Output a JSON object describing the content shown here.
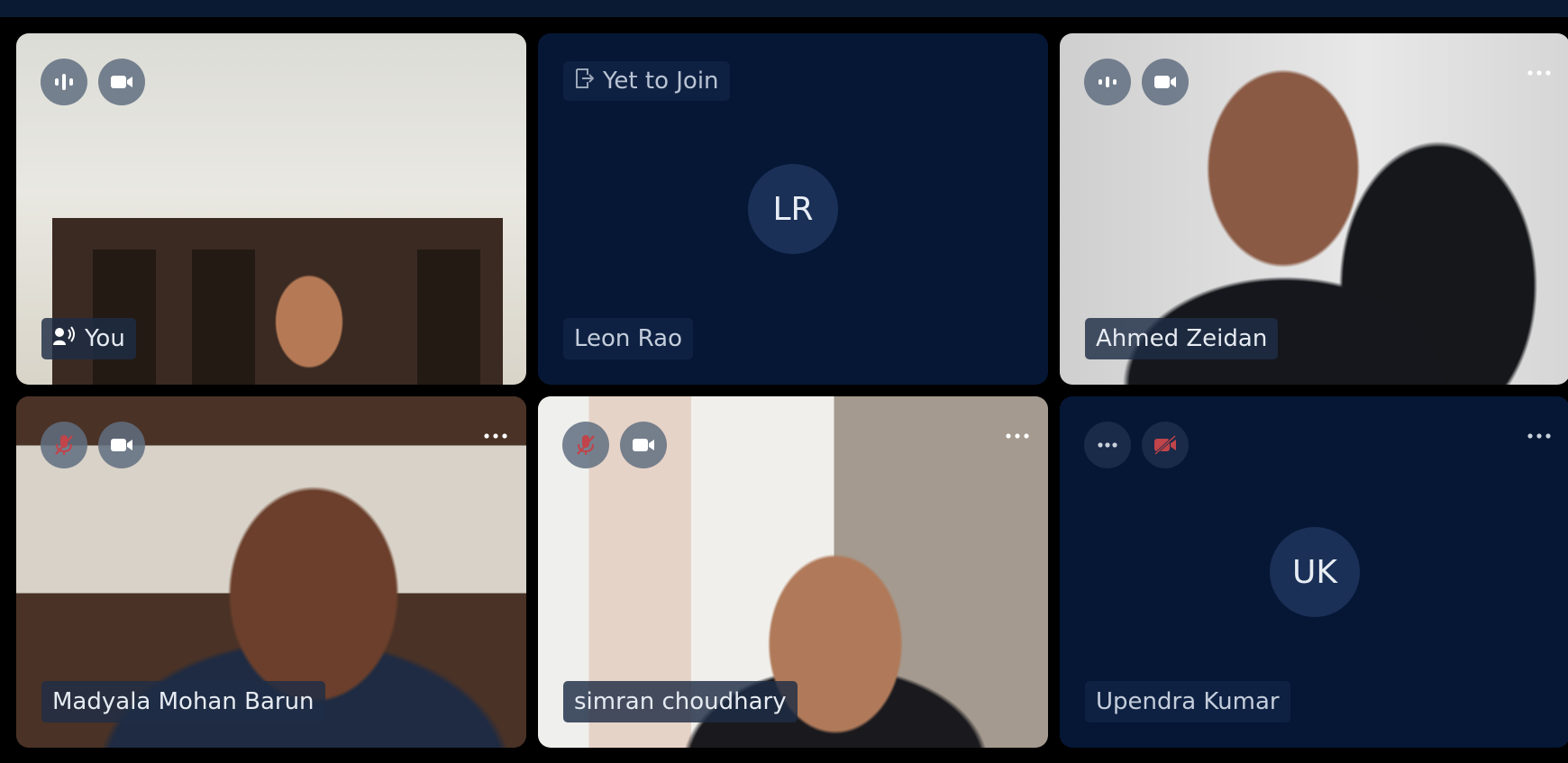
{
  "participants": [
    {
      "name": "You",
      "has_speaking_indicator": true,
      "mic_icon": "audio-level-icon",
      "camera_icon": "video-camera-icon",
      "view": "video"
    },
    {
      "status": "Yet to Join",
      "status_icon": "exit-door-icon",
      "initials": "LR",
      "name": "Leon Rao",
      "view": "avatar"
    },
    {
      "name": "Ahmed Zeidan",
      "mic_icon": "audio-level-icon",
      "camera_icon": "video-camera-icon",
      "more_icon": "more-options-icon",
      "view": "video"
    },
    {
      "name": "Madyala Mohan Barun",
      "mic_icon": "microphone-muted-icon",
      "camera_icon": "video-camera-icon",
      "more_icon": "more-options-icon",
      "view": "video"
    },
    {
      "name": "simran choudhary",
      "mic_icon": "microphone-muted-icon",
      "camera_icon": "video-camera-icon",
      "more_icon": "more-options-icon",
      "view": "video"
    },
    {
      "initials": "UK",
      "name": "Upendra Kumar",
      "mic_icon": "more-dots-icon",
      "camera_icon": "video-camera-off-icon",
      "more_icon": "more-options-icon",
      "view": "avatar"
    }
  ],
  "colors": {
    "background": "#000000",
    "tile_empty": "#061736",
    "avatar_circle": "#1b3057",
    "control_button": "#606e80",
    "muted_red": "#c0444a"
  }
}
